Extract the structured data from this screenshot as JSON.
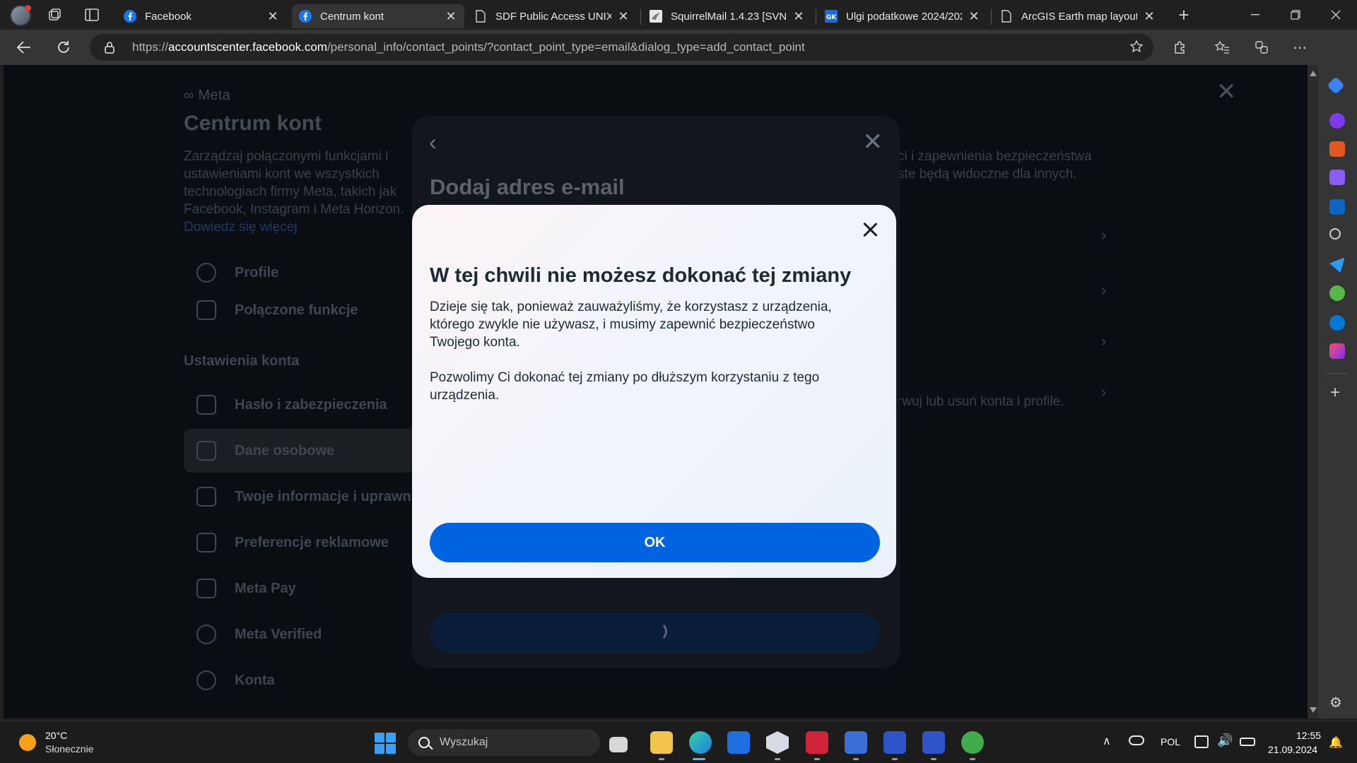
{
  "browser": {
    "tabs": [
      {
        "title": "Facebook",
        "favicon": "facebook-icon",
        "active": false
      },
      {
        "title": "Centrum kont",
        "favicon": "facebook-icon",
        "active": true
      },
      {
        "title": "SDF Public Access UNIX S",
        "favicon": "page-icon",
        "active": false
      },
      {
        "title": "SquirrelMail 1.4.23 [SVN]",
        "favicon": "squirrelmail-icon",
        "active": false
      },
      {
        "title": "Ulgi podatkowe 2024/202",
        "favicon": "gk-icon",
        "active": false
      },
      {
        "title": "ArcGIS Earth map layout",
        "favicon": "page-icon",
        "active": false
      }
    ],
    "url_host": "accountscenter.facebook.com",
    "url_prefix": "https://",
    "url_path": "/personal_info/contact_points/?contact_point_type=email&dialog_type=add_contact_point"
  },
  "background_page": {
    "brand": "Meta",
    "title": "Centrum kont",
    "description": "Zarządzaj połączonymi funkcjami i ustawieniami kont we wszystkich technologiach firmy Meta, takich jak Facebook, Instagram i Meta Horizon.",
    "learn_more": "Dowiedz się więcej",
    "nav_top": [
      {
        "label": "Profile"
      },
      {
        "label": "Połączone funkcje"
      }
    ],
    "section_heading": "Ustawienia konta",
    "nav_settings": [
      {
        "label": "Hasło i zabezpieczenia"
      },
      {
        "label": "Dane osobowe"
      },
      {
        "label": "Twoje informacje i uprawn"
      },
      {
        "label": "Preferencje reklamowe"
      },
      {
        "label": "Meta Pay"
      },
      {
        "label": "Meta Verified"
      },
      {
        "label": "Konta"
      }
    ],
    "right_text_1": "ci i zapewnienia bezpieczeństwa",
    "right_text_2": "ste będą widoczne dla innych.",
    "right_row": "rwuj lub usuń konta i profile."
  },
  "back_dialog": {
    "title": "Dodaj adres e-mail"
  },
  "modal": {
    "title": "W tej chwili nie możesz dokonać tej zmiany",
    "paragraph_1": "Dzieje się tak, ponieważ zauważyliśmy, że korzystasz z urządzenia, którego zwykle nie używasz, i musimy zapewnić bezpieczeństwo Twojego konta.",
    "paragraph_2": "Pozwolimy Ci dokonać tej zmiany po dłuższym korzystaniu z tego urządzenia.",
    "ok_label": "OK",
    "ok_color": "#0064e0"
  },
  "taskbar": {
    "weather_temp": "20°C",
    "weather_desc": "Słonecznie",
    "search_placeholder": "Wyszukaj",
    "language": "POL",
    "time": "12:55",
    "date": "21.09.2024"
  }
}
